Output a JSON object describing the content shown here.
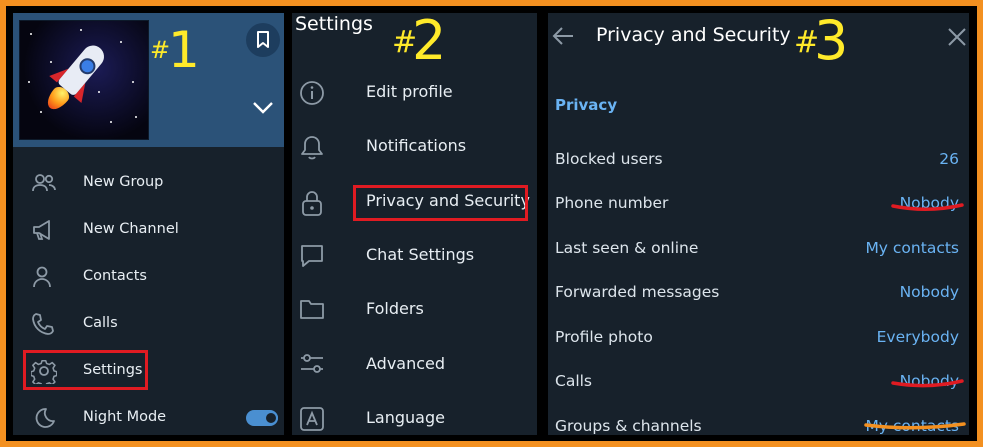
{
  "annotations": {
    "n1": "1",
    "n2": "2",
    "n3": "3",
    "hash": "#"
  },
  "panel1": {
    "menu": [
      {
        "label": "New Group",
        "icon": "group-icon"
      },
      {
        "label": "New Channel",
        "icon": "megaphone-icon"
      },
      {
        "label": "Contacts",
        "icon": "person-icon"
      },
      {
        "label": "Calls",
        "icon": "phone-icon"
      },
      {
        "label": "Settings",
        "icon": "gear-icon"
      },
      {
        "label": "Night Mode",
        "icon": "moon-icon",
        "toggle": true
      }
    ]
  },
  "panel2": {
    "title": "Settings",
    "items": [
      {
        "label": "Edit profile",
        "icon": "info-icon"
      },
      {
        "label": "Notifications",
        "icon": "bell-icon"
      },
      {
        "label": "Privacy and Security",
        "icon": "lock-icon"
      },
      {
        "label": "Chat Settings",
        "icon": "chat-icon"
      },
      {
        "label": "Folders",
        "icon": "folder-icon"
      },
      {
        "label": "Advanced",
        "icon": "sliders-icon"
      },
      {
        "label": "Language",
        "icon": "language-icon"
      }
    ]
  },
  "panel3": {
    "title": "Privacy and Security",
    "section": "Privacy",
    "rows": [
      {
        "label": "Blocked users",
        "value": "26"
      },
      {
        "label": "Phone number",
        "value": "Nobody"
      },
      {
        "label": "Last seen & online",
        "value": "My contacts"
      },
      {
        "label": "Forwarded messages",
        "value": "Nobody"
      },
      {
        "label": "Profile photo",
        "value": "Everybody"
      },
      {
        "label": "Calls",
        "value": "Nobody"
      },
      {
        "label": "Groups & channels",
        "value": "My contacts"
      }
    ]
  },
  "colors": {
    "accent": "#6ab3f3",
    "panel": "#17212b",
    "header": "#2b5278",
    "highlight_box": "#e01b22",
    "underline_orange": "#f39020",
    "annotation": "#ffea2a",
    "border": "#f39020"
  }
}
